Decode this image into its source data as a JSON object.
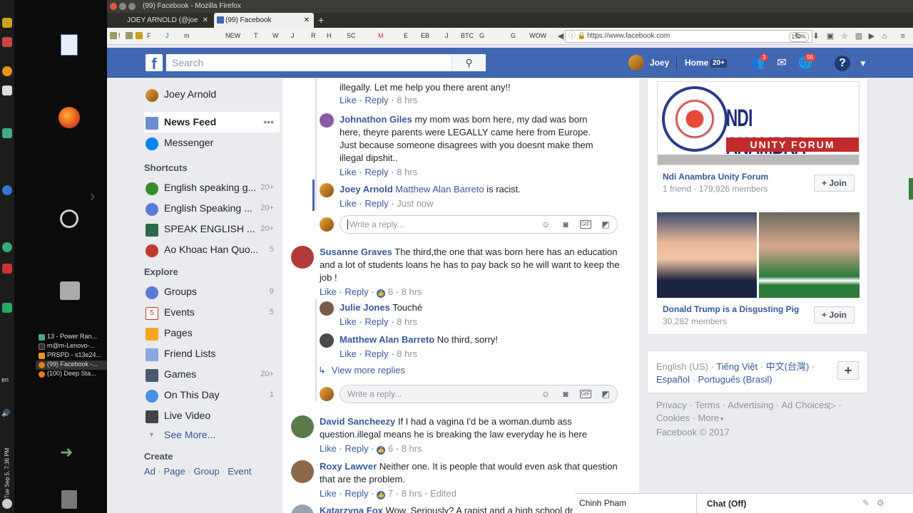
{
  "window": {
    "title": "(99) Facebook - Mozilla Firefox",
    "tabs": [
      {
        "label": "JOEY ARNOLD (@joe"
      },
      {
        "label": "(99) Facebook"
      }
    ],
    "new_tab": "+",
    "url": "https://www.facebook.com",
    "zoom": "150%"
  },
  "bookmarks": [
    "!",
    "F",
    "J",
    "m",
    "NEW",
    "T",
    "W",
    "J",
    "R",
    "H",
    "SC",
    "M",
    "E",
    "EB",
    "J",
    "BTC",
    "G",
    "G",
    "WOW"
  ],
  "taskbar": {
    "items": [
      {
        "label": "13 - Power Ran..."
      },
      {
        "label": "m@m-Lenovo-..."
      },
      {
        "label": "PRSPD - s13e24..."
      },
      {
        "label": "(99) Facebook -..."
      },
      {
        "label": "(100) Deep Sta..."
      }
    ],
    "clock": "Tue Sep 5, 7:36 PM",
    "lang": "en"
  },
  "fb": {
    "search_placeholder": "Search",
    "user": "Joey",
    "home": "Home",
    "home_count": "20+",
    "friend_badge": "3",
    "notif_badge": "96",
    "help": "?"
  },
  "leftnav": {
    "profile": "Joey Arnold",
    "news_feed": "News Feed",
    "messenger": "Messenger",
    "shortcuts_heading": "Shortcuts",
    "shortcuts": [
      {
        "label": "English speaking g...",
        "count": "20+"
      },
      {
        "label": "English Speaking ...",
        "count": "20+"
      },
      {
        "label": "SPEAK ENGLISH ...",
        "count": "20+"
      },
      {
        "label": "Ao Khoac Han Quo...",
        "count": "5"
      }
    ],
    "explore_heading": "Explore",
    "explore": [
      {
        "label": "Groups",
        "count": "9"
      },
      {
        "label": "Events",
        "count": "5"
      },
      {
        "label": "Pages",
        "count": ""
      },
      {
        "label": "Friend Lists",
        "count": ""
      },
      {
        "label": "Games",
        "count": "20+"
      },
      {
        "label": "On This Day",
        "count": "1"
      },
      {
        "label": "Live Video",
        "count": ""
      }
    ],
    "see_more": "See More...",
    "create_heading": "Create",
    "create_links": [
      "Ad",
      "Page",
      "Group",
      "Event"
    ]
  },
  "comments": {
    "c0": {
      "text": "illegally. Let me help you there arent any!!",
      "like": "Like",
      "reply": "Reply",
      "time": "8 hrs"
    },
    "c1": {
      "name": "Johnathon Giles",
      "text": "my mom was born here, my dad was born here, theyre parents were LEGALLY came here from Europe. Just because someone disagrees with you doesnt make them illegal dipshit..",
      "like": "Like",
      "reply": "Reply",
      "time": "8 hrs"
    },
    "c2": {
      "name": "Joey Arnold",
      "mention": "Matthew Alan Barreto",
      "text": "is racist.",
      "like": "Like",
      "reply": "Reply",
      "time": "Just now"
    },
    "reply_placeholder": "Write a reply...",
    "c3": {
      "name": "Susanne Graves",
      "text": "The third,the one that was born here has an education and a lot of students loans he has to pay back so he will want to keep the job !",
      "like": "Like",
      "reply": "Reply",
      "reactions": "6",
      "time": "8 hrs"
    },
    "c4": {
      "name": "Julie Jones",
      "text": "Touché",
      "like": "Like",
      "reply": "Reply",
      "time": "8 hrs"
    },
    "c5": {
      "name": "Matthew Alan Barreto",
      "text": "No third, sorry!",
      "like": "Like",
      "reply": "Reply",
      "time": "8 hrs"
    },
    "view_more": "View more replies",
    "c6": {
      "name": "David Sancheezy",
      "text": "If I had a vagina I'd be a woman.dumb ass question.illegal means he is breaking the law everyday he is here",
      "like": "Like",
      "reply": "Reply",
      "reactions": "6",
      "time": "8 hrs"
    },
    "c7": {
      "name": "Roxy Lawver",
      "text": "Neither one. It is people that would even ask that question that are the problem.",
      "like": "Like",
      "reply": "Reply",
      "reactions": "7",
      "time": "8 hrs",
      "edited": "Edited"
    },
    "c8": {
      "name": "Katarzyna Fox",
      "text": "Wow. Seriously? A rapist and a high school dr"
    }
  },
  "right": {
    "group1": {
      "banner_top": "NDI ANAMBRA",
      "banner_bottom": "UNITY FORUM",
      "name": "Ndi Anambra Unity Forum",
      "meta": "1 friend · 179,926 members",
      "join": "Join"
    },
    "group2": {
      "name": "Donald Trump is a Disgusting Pig",
      "meta": "30,282 members",
      "join": "Join"
    },
    "languages": {
      "current": "English (US)",
      "l1": "Tiếng Việt",
      "l2": "中文(台灣)",
      "l3": "Español",
      "l4": "Português (Brasil)",
      "add": "+"
    },
    "footer": {
      "privacy": "Privacy",
      "terms": "Terms",
      "advertising": "Advertising",
      "adchoices": "Ad Choices",
      "cookies": "Cookies",
      "more": "More",
      "copyright": "Facebook © 2017"
    }
  },
  "chat": {
    "person": "Chinh Pham",
    "status": "Chat (Off)"
  },
  "colors": {
    "fb_blue": "#4267b2",
    "link": "#385898",
    "bg": "#e9ebee"
  }
}
